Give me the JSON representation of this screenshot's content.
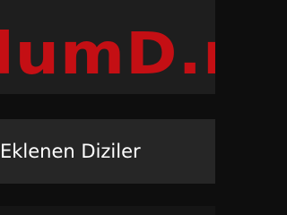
{
  "header": {
    "logo_text": "lumD.n"
  },
  "section": {
    "title": "Eklenen Diziler"
  },
  "colors": {
    "background": "#0e0e0e",
    "header_bg": "#1e1e1e",
    "logo": "#c40f14",
    "section_bg": "#262626",
    "text": "#ffffff"
  }
}
